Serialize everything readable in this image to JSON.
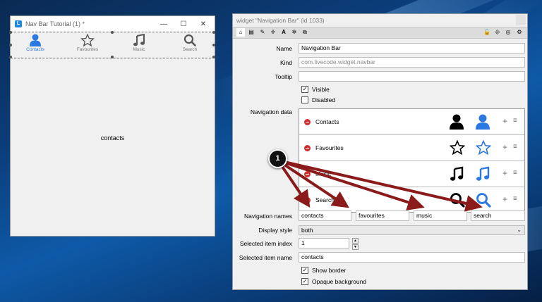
{
  "colors": {
    "accent": "#2b79e0",
    "arrow": "#8b1a1a",
    "remove": "#d32f2f"
  },
  "left_window": {
    "title": "Nav Bar Tutorial (1) *",
    "nav": [
      {
        "label": "Contacts",
        "icon": "person-icon",
        "selected": true
      },
      {
        "label": "Favourites",
        "icon": "star-icon",
        "selected": false
      },
      {
        "label": "Music",
        "icon": "music-note-icon",
        "selected": false
      },
      {
        "label": "Search",
        "icon": "search-icon",
        "selected": false
      }
    ],
    "content_text": "contacts"
  },
  "inspector": {
    "title": "widget \"Navigation Bar\" (id 1033)",
    "labels": {
      "name": "Name",
      "kind": "Kind",
      "tooltip": "Tooltip",
      "navigation_data": "Navigation data",
      "navigation_names": "Navigation names",
      "display_style": "Display style",
      "selected_item_index": "Selected item index",
      "selected_item_name": "Selected item name"
    },
    "name": "Navigation Bar",
    "kind": "com.livecode.widget.navbar",
    "tooltip": "",
    "visible_label": "Visible",
    "disabled_label": "Disabled",
    "nav_rows": [
      {
        "label": "Contacts",
        "icon": "person-icon"
      },
      {
        "label": "Favourites",
        "icon": "star-icon"
      },
      {
        "label": "Music",
        "icon": "music-note-icon"
      },
      {
        "label": "Search",
        "icon": "search-icon"
      }
    ],
    "nav_names": [
      "contacts",
      "favourites",
      "music",
      "search"
    ],
    "display_style": "both",
    "selected_item_index": "1",
    "selected_item_name": "contacts",
    "show_border_label": "Show border",
    "opaque_background_label": "Opaque background"
  },
  "callout": "1"
}
